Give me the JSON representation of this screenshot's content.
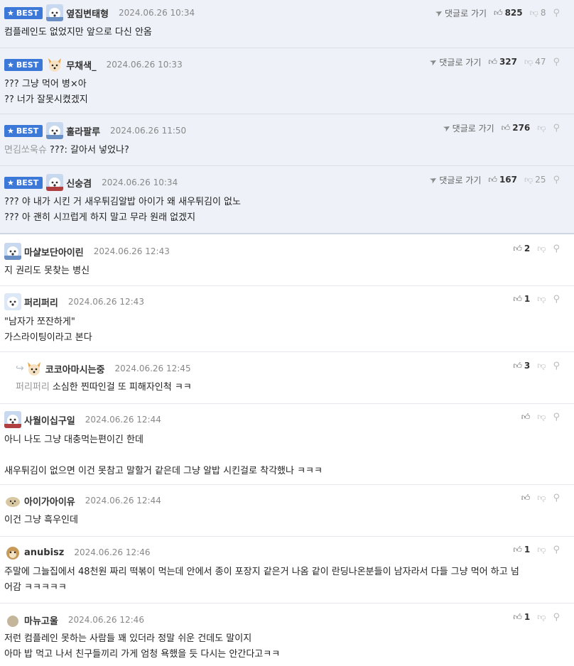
{
  "labels": {
    "best": "BEST",
    "goto": "댓글로 가기"
  },
  "colors": {
    "badge": "#3b78d8",
    "best_bg": "#eef2f8"
  },
  "best_comments": [
    {
      "nick": "옆집변태형",
      "date": "2024.06.26 10:34",
      "up": "825",
      "down": "8",
      "avatar": "dog-icon",
      "lines": "컴플레인도 없었지만 앞으로 다신 안옴"
    },
    {
      "nick": "무채색_",
      "date": "2024.06.26 10:33",
      "up": "327",
      "down": "47",
      "avatar": "fox-icon",
      "lines": "??? 그냥 먹어 병×아\n?? 너가 잘못시켰겠지"
    },
    {
      "nick": "훌라팔루",
      "date": "2024.06.26 11:50",
      "up": "276",
      "down": "",
      "avatar": "dog-icon",
      "mention": "면김쏘욱슈",
      "lines": "???: 갈아서 넣었나?"
    },
    {
      "nick": "신숭겸",
      "date": "2024.06.26 10:34",
      "up": "167",
      "down": "25",
      "avatar": "dog-icon",
      "lines": "??? 야 내가 시킨 거 새우튀김알밥 아이가 왜 새우튀김이 없노\n??? 아 괜히 시끄럽게 하지 말고 무라 원래 없겠지"
    }
  ],
  "comments": [
    {
      "nick": "마샬보단아이린",
      "date": "2024.06.26 12:43",
      "up": "2",
      "avatar": "dog-icon",
      "lines": "지 권리도 못찾는 병신"
    },
    {
      "nick": "퍼리퍼리",
      "date": "2024.06.26 12:43",
      "up": "1",
      "avatar": "dog-icon",
      "lines": "\"남자가 쪼잔하게\"\n가스라이팅이라고 본다"
    },
    {
      "nick": "코코아마시는중",
      "date": "2024.06.26 12:45",
      "up": "3",
      "avatar": "fox-icon",
      "reply": true,
      "mention": "퍼리퍼리",
      "lines": "소심한 찐따인걸 또 피해자인척 ㅋㅋ"
    },
    {
      "nick": "사월이십구일",
      "date": "2024.06.26 12:44",
      "up": "",
      "avatar": "dog-icon",
      "lines": "아니 나도 그냥 대충먹는편이긴 한데\n\n새우튀김이 없으면 이건 못참고 말할거 같은데 그냥 알밥 시킨걸로 착각했나 ㅋㅋㅋ"
    },
    {
      "nick": "아이가아이유",
      "date": "2024.06.26 12:44",
      "up": "",
      "avatar": "seal-icon",
      "lines": "이건 그냥 흑우인데"
    },
    {
      "nick": "anubisz",
      "date": "2024.06.26 12:46",
      "up": "1",
      "avatar": "hamster-icon",
      "lines": "주말에 그늘집에서 48천원 짜리 떡볶이 먹는데 안에서 종이 포장지 같은거 나옴 같이 란딩나온분들이 남자라서 다들 그냥 먹어 하고 넘\n어감 ㅋㅋㅋㅋㅋ"
    },
    {
      "nick": "마뉴고울",
      "date": "2024.06.26 12:46",
      "up": "1",
      "avatar": "dot-icon",
      "lines": "저런 컴플레인 못하는 사람들 꽤 있더라 정말 쉬운 건데도 말이지\n아마 밥 먹고 나서 친구들끼리 가게 엄청 욕했을 듯 다시는 안간다고ㅋㅋ"
    }
  ]
}
